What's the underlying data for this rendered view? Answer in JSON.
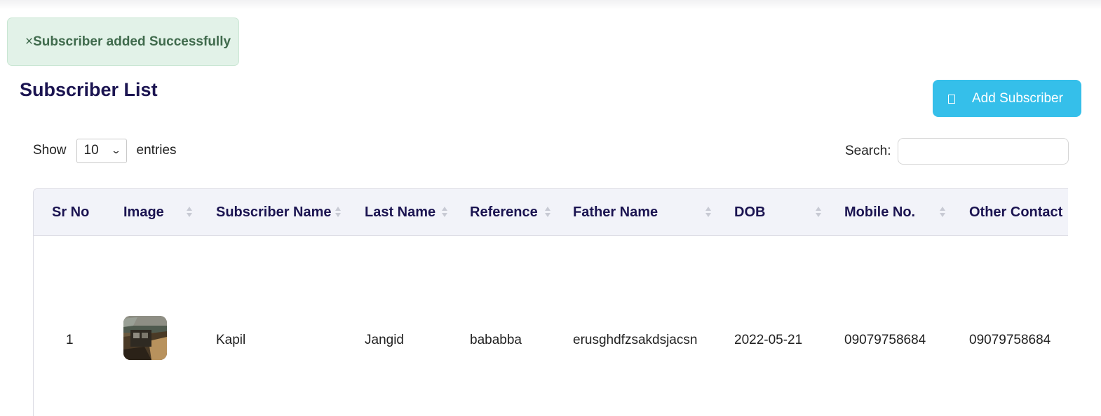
{
  "alert": {
    "close_glyph": "×",
    "message": "Subscriber added Successfully"
  },
  "page": {
    "title": "Subscriber List"
  },
  "toolbar": {
    "add_label": "Add Subscriber",
    "add_icon": "plus-square-icon",
    "accent_color": "#35bfea"
  },
  "length": {
    "prefix": "Show",
    "value": "10",
    "suffix": "entries"
  },
  "search": {
    "label": "Search:",
    "value": "",
    "placeholder": ""
  },
  "table": {
    "columns": [
      "Sr No",
      "Image",
      "Subscriber Name",
      "Last Name",
      "Reference",
      "Father Name",
      "DOB",
      "Mobile No.",
      "Other Contact"
    ],
    "rows": [
      {
        "sr_no": "1",
        "image": "subscriber-photo",
        "subscriber_name": "Kapil",
        "last_name": "Jangid",
        "reference": "bababba",
        "father_name": "erusghdfzsakdsjacsn",
        "dob": "2022-05-21",
        "mobile": "09079758684",
        "other_contact": "09079758684"
      }
    ]
  }
}
